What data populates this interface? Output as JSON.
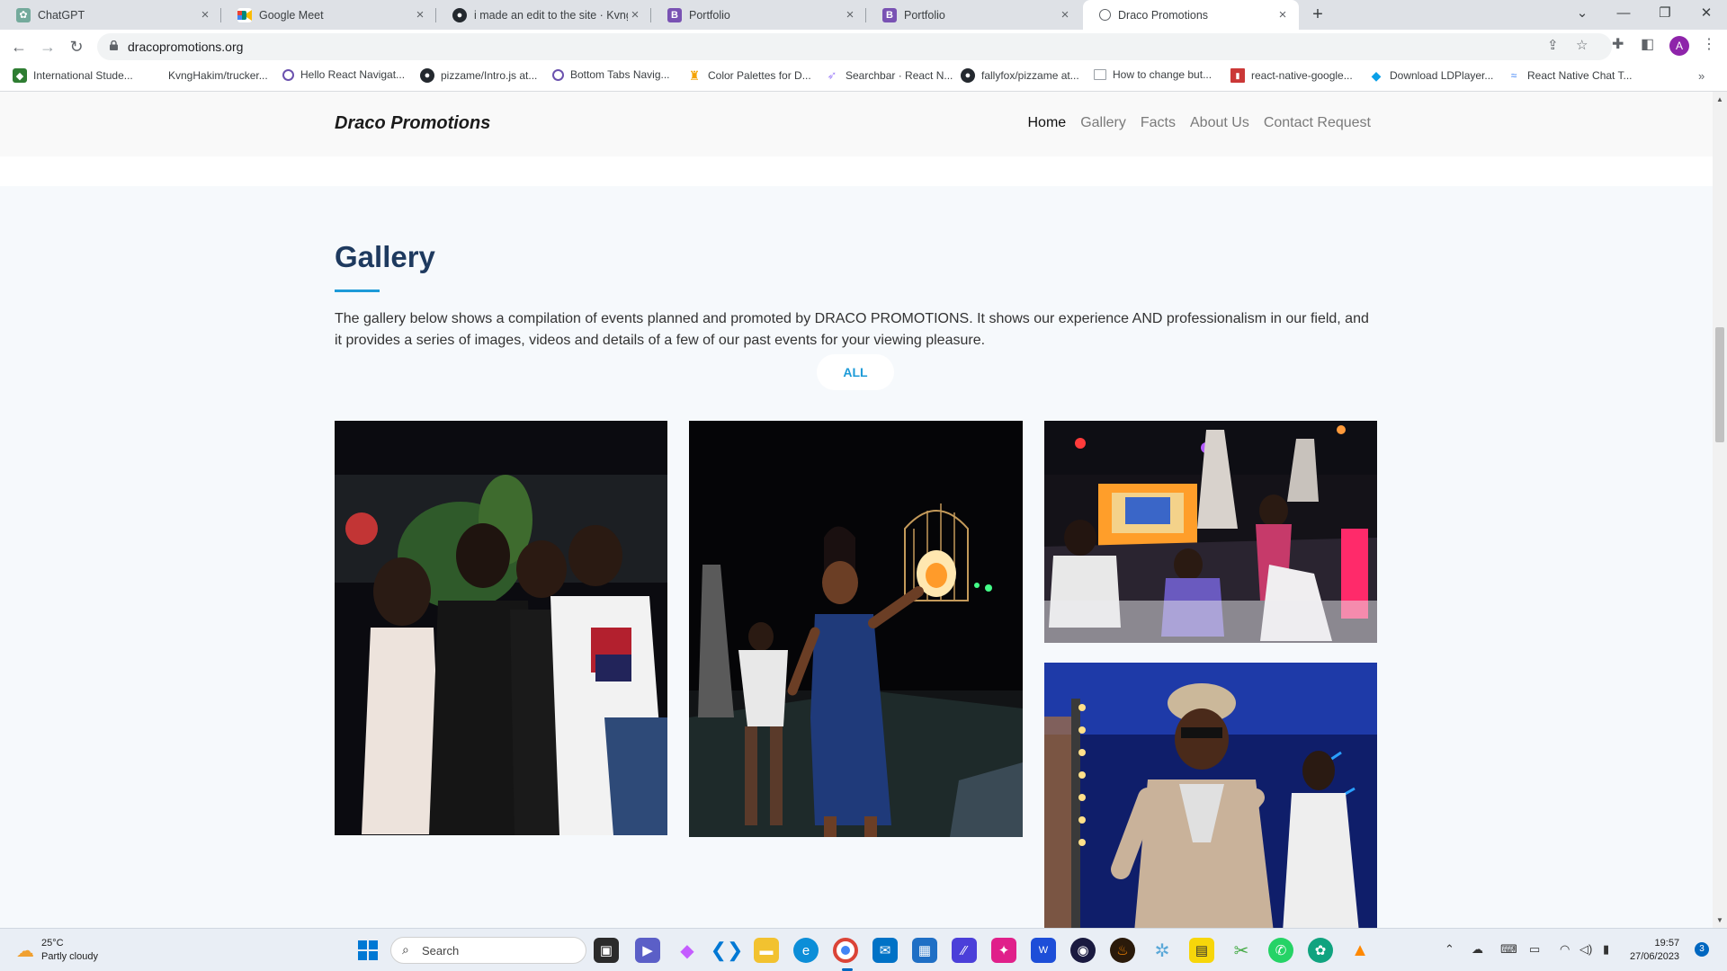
{
  "browser": {
    "tabs": [
      {
        "title": "ChatGPT",
        "icon": "chatgpt-icon",
        "color": "#74aa9c",
        "active": false
      },
      {
        "title": "Google Meet",
        "icon": "google-meet-icon",
        "color": "#00897b",
        "active": false
      },
      {
        "title": "i made an edit to the site · KvngH",
        "icon": "github-icon",
        "color": "#24292f",
        "active": false
      },
      {
        "title": "Portfolio",
        "icon": "bootstrap-icon",
        "color": "#7952b3",
        "active": false
      },
      {
        "title": "Portfolio",
        "icon": "bootstrap-icon",
        "color": "#7952b3",
        "active": false
      },
      {
        "title": "Draco Promotions",
        "icon": "globe-icon",
        "color": "#5f6368",
        "active": true
      }
    ],
    "url": "dracopromotions.org",
    "profile_initial": "A",
    "bookmarks": [
      {
        "label": "International Stude...",
        "icon": "shield-icon",
        "color": "#2e7d32"
      },
      {
        "label": "KvngHakim/trucker...",
        "icon": "blank-icon",
        "color": "#ffffff"
      },
      {
        "label": "Hello React Navigat...",
        "icon": "react-navigation-icon",
        "color": "#6b52ae"
      },
      {
        "label": "pizzame/Intro.js at...",
        "icon": "github-icon",
        "color": "#24292f"
      },
      {
        "label": "Bottom Tabs Navig...",
        "icon": "react-navigation-icon",
        "color": "#6b52ae"
      },
      {
        "label": "Color Palettes for D...",
        "icon": "palette-icon",
        "color": "#f4a300"
      },
      {
        "label": "Searchbar · React N...",
        "icon": "react-native-paper-icon",
        "color": "#a78bfa"
      },
      {
        "label": "fallyfox/pizzame at...",
        "icon": "github-icon",
        "color": "#24292f"
      },
      {
        "label": "How to change but...",
        "icon": "document-icon",
        "color": "#9aa0a6"
      },
      {
        "label": "react-native-google...",
        "icon": "npm-icon",
        "color": "#cb3837"
      },
      {
        "label": "Download LDPlayer...",
        "icon": "ldplayer-icon",
        "color": "#0aa0e8"
      },
      {
        "label": "React Native Chat T...",
        "icon": "chat-icon",
        "color": "#3b82f6"
      }
    ]
  },
  "site": {
    "brand": "Draco Promotions",
    "nav": [
      {
        "label": "Home",
        "active": true
      },
      {
        "label": "Gallery",
        "active": false
      },
      {
        "label": "Facts",
        "active": false
      },
      {
        "label": "About Us",
        "active": false
      },
      {
        "label": "Contact Request",
        "active": false
      }
    ],
    "gallery": {
      "title": "Gallery",
      "description": "The gallery below shows a compilation of events planned and promoted by DRACO PROMOTIONS. It shows our experience AND professionalism in our field, and it provides a series of images, videos and details of a few of our past events for your viewing pleasure.",
      "filter_label": "ALL",
      "accent_color": "#1d9bd8",
      "title_color": "#1e3a5f"
    }
  },
  "taskbar": {
    "weather_temp": "25°C",
    "weather_desc": "Partly cloudy",
    "search_placeholder": "Search",
    "time": "19:57",
    "date": "27/06/2023",
    "notification_count": "3"
  }
}
